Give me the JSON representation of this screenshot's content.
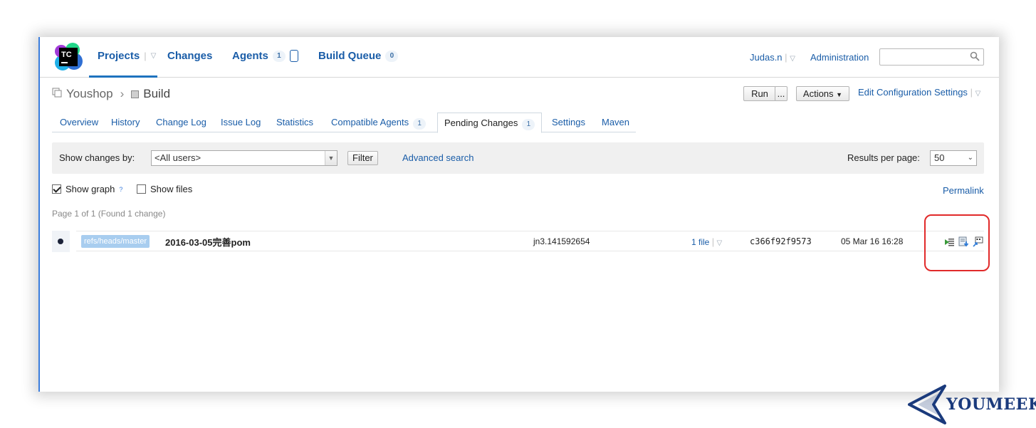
{
  "header": {
    "logo_text": "TC",
    "nav": [
      {
        "label": "Projects"
      },
      {
        "label": "Changes"
      },
      {
        "label": "Agents",
        "count": "1"
      },
      {
        "label": "Build Queue",
        "count": "0"
      }
    ],
    "user": "Judas.n",
    "admin": "Administration",
    "search_placeholder": ""
  },
  "breadcrumb": {
    "project": "Youshop",
    "build": "Build"
  },
  "actions": {
    "run": "Run",
    "run_more": "...",
    "actions": "Actions",
    "edit": "Edit Configuration Settings"
  },
  "tabs": [
    {
      "label": "Overview"
    },
    {
      "label": "History"
    },
    {
      "label": "Change Log"
    },
    {
      "label": "Issue Log"
    },
    {
      "label": "Statistics"
    },
    {
      "label": "Compatible Agents",
      "count": "1"
    },
    {
      "label": "Pending Changes",
      "count": "1",
      "active": true
    },
    {
      "label": "Settings"
    },
    {
      "label": "Maven"
    }
  ],
  "filter": {
    "label": "Show changes by:",
    "selected_user": "<All users>",
    "filter_button": "Filter",
    "advanced": "Advanced search",
    "rpp_label": "Results per page:",
    "rpp_value": "50"
  },
  "options": {
    "show_graph": "Show graph",
    "help_mark": "?",
    "show_files": "Show files",
    "permalink": "Permalink"
  },
  "page_info": "Page 1 of 1 (Found 1 change)",
  "changes": [
    {
      "branch": "refs/heads/master",
      "title": "2016-03-05完善pom",
      "user": "jn3.141592654",
      "files": "1 file",
      "hash": "c366f92f9573",
      "date": "05 Mar 16 16:28"
    }
  ],
  "watermark": "YOUMEEK",
  "colors": {
    "link": "#1a5da8",
    "accent_underline": "#1e73be",
    "highlight": "#e12a2a",
    "branch_tag": "#a8cdef"
  }
}
